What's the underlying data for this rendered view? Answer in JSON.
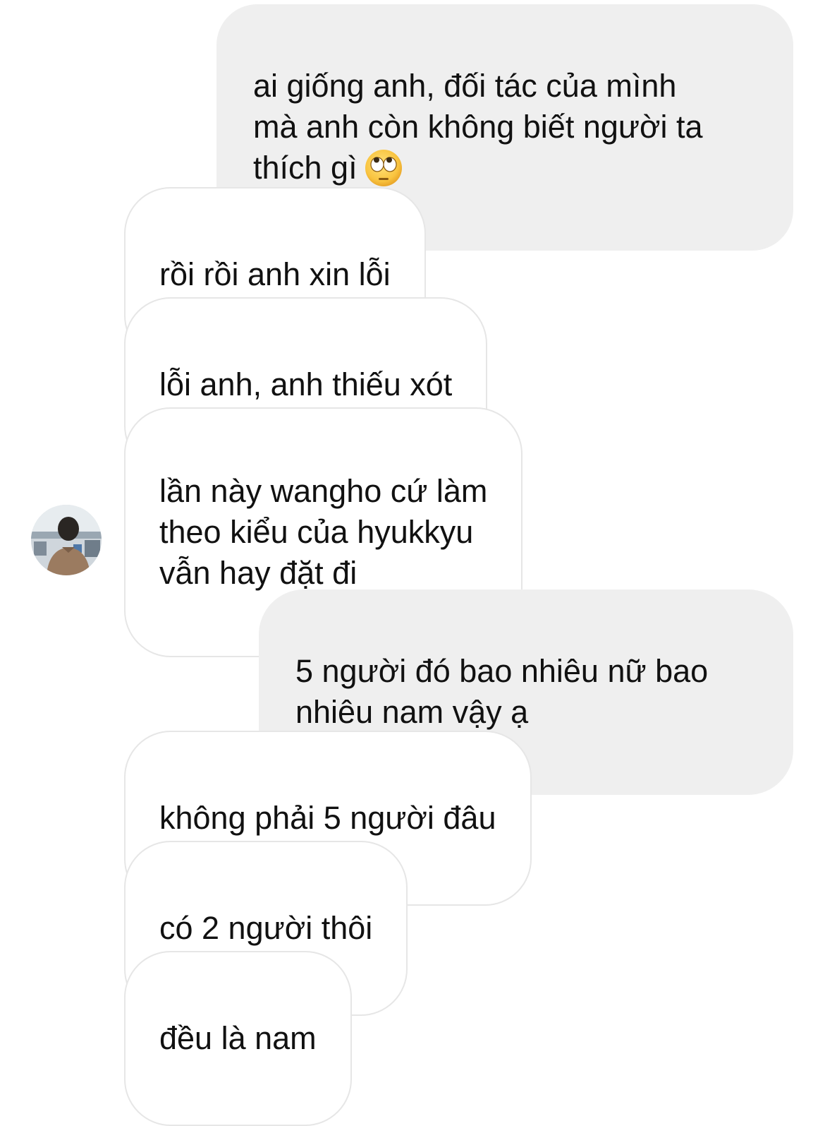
{
  "messages": [
    {
      "direction": "sent",
      "text": "ai giống anh, đối tác của mình\nmà anh còn không biết người ta\nthích gì",
      "emoji": "face-with-rolling-eyes"
    },
    {
      "direction": "received",
      "text": "rồi rồi anh xin lỗi"
    },
    {
      "direction": "received",
      "text": "lỗi anh, anh thiếu xót"
    },
    {
      "direction": "received",
      "text": "lần này wangho cứ làm\ntheo kiểu của hyukkyu\nvẫn hay đặt đi"
    },
    {
      "direction": "sent",
      "text": "5 người đó bao nhiêu nữ bao\nnhiêu nam vậy ạ"
    },
    {
      "direction": "received",
      "text": "không phải 5 người đâu"
    },
    {
      "direction": "received",
      "text": "có 2 người thôi"
    },
    {
      "direction": "received",
      "text": "đều là nam"
    }
  ],
  "colors": {
    "sent_bubble": "#efefef",
    "received_border": "#e6e6e6",
    "text": "#111111"
  },
  "avatar_icon": "profile-photo-avatar"
}
